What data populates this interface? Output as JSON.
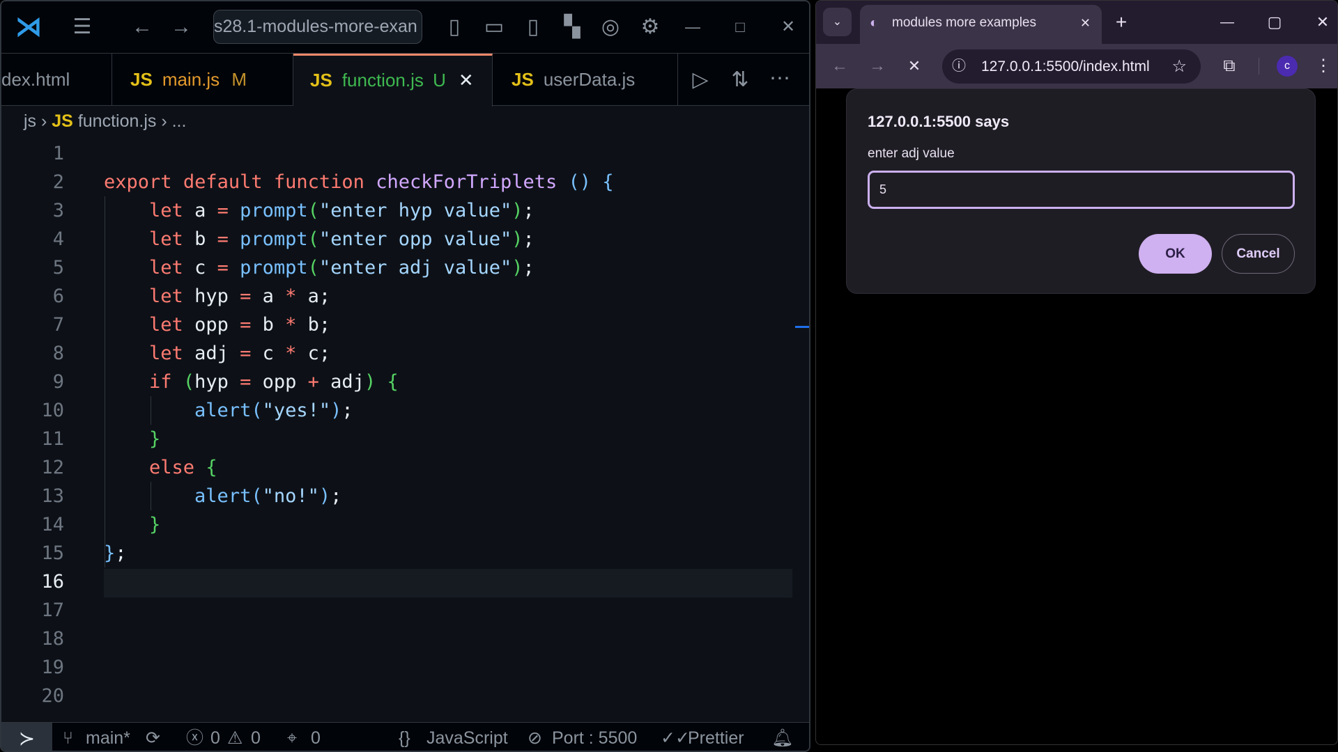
{
  "vscode": {
    "command_center": "s28.1-modules-more-exan",
    "tabs": [
      {
        "name": "dex.html",
        "badge": "",
        "icon": ""
      },
      {
        "name": "main.js",
        "badge": "M",
        "icon": "JS"
      },
      {
        "name": "function.js",
        "badge": "U",
        "icon": "JS",
        "active": true
      },
      {
        "name": "userData.js",
        "badge": "",
        "icon": "JS"
      }
    ],
    "breadcrumb": {
      "folder": "js",
      "icon": "JS",
      "file": "function.js",
      "more": "..."
    },
    "current_line": 16,
    "code": [
      [],
      [
        [
          "export",
          "kw"
        ],
        [
          " ",
          "p"
        ],
        [
          "default",
          "kw"
        ],
        [
          " ",
          "p"
        ],
        [
          "function",
          "kw"
        ],
        [
          " ",
          "p"
        ],
        [
          "checkForTriplets",
          "fn"
        ],
        [
          " ",
          "p"
        ],
        [
          "()",
          "b1"
        ],
        [
          " ",
          "p"
        ],
        [
          "{",
          "b1"
        ]
      ],
      [
        [
          "    ",
          "p"
        ],
        [
          "let",
          "kw"
        ],
        [
          " a ",
          "id"
        ],
        [
          "=",
          "op"
        ],
        [
          " ",
          "p"
        ],
        [
          "prompt",
          "bi"
        ],
        [
          "(",
          "b2"
        ],
        [
          "\"enter hyp value\"",
          "st"
        ],
        [
          ")",
          "b2"
        ],
        [
          ";",
          "p"
        ]
      ],
      [
        [
          "    ",
          "p"
        ],
        [
          "let",
          "kw"
        ],
        [
          " b ",
          "id"
        ],
        [
          "=",
          "op"
        ],
        [
          " ",
          "p"
        ],
        [
          "prompt",
          "bi"
        ],
        [
          "(",
          "b2"
        ],
        [
          "\"enter opp value\"",
          "st"
        ],
        [
          ")",
          "b2"
        ],
        [
          ";",
          "p"
        ]
      ],
      [
        [
          "    ",
          "p"
        ],
        [
          "let",
          "kw"
        ],
        [
          " c ",
          "id"
        ],
        [
          "=",
          "op"
        ],
        [
          " ",
          "p"
        ],
        [
          "prompt",
          "bi"
        ],
        [
          "(",
          "b2"
        ],
        [
          "\"enter adj value\"",
          "st"
        ],
        [
          ")",
          "b2"
        ],
        [
          ";",
          "p"
        ]
      ],
      [
        [
          "    ",
          "p"
        ],
        [
          "let",
          "kw"
        ],
        [
          " hyp ",
          "id"
        ],
        [
          "=",
          "op"
        ],
        [
          " a ",
          "id"
        ],
        [
          "*",
          "op"
        ],
        [
          " a;",
          "id"
        ]
      ],
      [
        [
          "    ",
          "p"
        ],
        [
          "let",
          "kw"
        ],
        [
          " opp ",
          "id"
        ],
        [
          "=",
          "op"
        ],
        [
          " b ",
          "id"
        ],
        [
          "*",
          "op"
        ],
        [
          " b;",
          "id"
        ]
      ],
      [
        [
          "    ",
          "p"
        ],
        [
          "let",
          "kw"
        ],
        [
          " adj ",
          "id"
        ],
        [
          "=",
          "op"
        ],
        [
          " c ",
          "id"
        ],
        [
          "*",
          "op"
        ],
        [
          " c;",
          "id"
        ]
      ],
      [
        [
          "    ",
          "p"
        ],
        [
          "if",
          "kw"
        ],
        [
          " ",
          "p"
        ],
        [
          "(",
          "b2"
        ],
        [
          "hyp ",
          "id"
        ],
        [
          "=",
          "op"
        ],
        [
          " opp ",
          "id"
        ],
        [
          "+",
          "op"
        ],
        [
          " adj",
          "id"
        ],
        [
          ")",
          "b2"
        ],
        [
          " ",
          "p"
        ],
        [
          "{",
          "b2"
        ]
      ],
      [
        [
          "        ",
          "p"
        ],
        [
          "alert",
          "bi"
        ],
        [
          "(",
          "b1"
        ],
        [
          "\"yes!\"",
          "st"
        ],
        [
          ")",
          "b1"
        ],
        [
          ";",
          "p"
        ]
      ],
      [
        [
          "    ",
          "p"
        ],
        [
          "}",
          "b2"
        ]
      ],
      [
        [
          "    ",
          "p"
        ],
        [
          "else",
          "kw"
        ],
        [
          " ",
          "p"
        ],
        [
          "{",
          "b2"
        ]
      ],
      [
        [
          "        ",
          "p"
        ],
        [
          "alert",
          "bi"
        ],
        [
          "(",
          "b1"
        ],
        [
          "\"no!\"",
          "st"
        ],
        [
          ")",
          "b1"
        ],
        [
          ";",
          "p"
        ]
      ],
      [
        [
          "    ",
          "p"
        ],
        [
          "}",
          "b2"
        ]
      ],
      [
        [
          "}",
          "b1"
        ],
        [
          ";",
          "p"
        ]
      ],
      [],
      [],
      [],
      [],
      []
    ],
    "status": {
      "branch": "main*",
      "errors": "0",
      "warnings": "0",
      "ports": "0",
      "language": "JavaScript",
      "port": "Port : 5500",
      "formatter": "Prettier"
    }
  },
  "browser": {
    "tab_title": "modules more examples",
    "url": "127.0.0.1:5500/index.html",
    "avatar": "c",
    "dialog": {
      "title": "127.0.0.1:5500 says",
      "message": "enter adj value",
      "value": "5",
      "ok": "OK",
      "cancel": "Cancel"
    },
    "colors": {
      "accent": "#cfb0f0",
      "tabbar": "#231c2f",
      "toolbar": "#3b3347"
    }
  }
}
